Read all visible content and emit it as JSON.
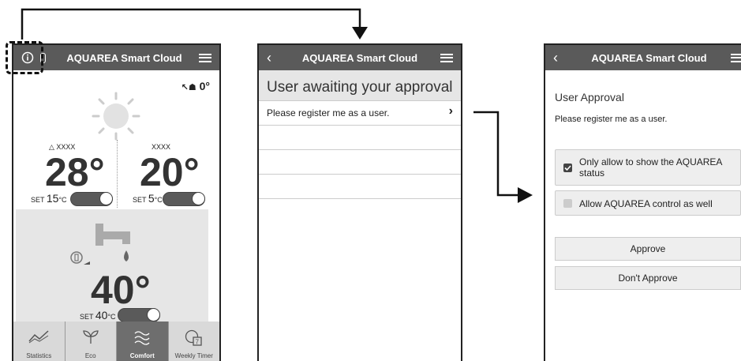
{
  "app_title": "AQUAREA Smart Cloud",
  "screen1": {
    "outdoor_temp": "0°",
    "zone1": {
      "name": "XXXX",
      "temp": "28°",
      "set_prefix": "SET",
      "set_value": "15",
      "set_unit": "°C"
    },
    "zone2": {
      "name": "XXXX",
      "temp": "20°",
      "set_prefix": "SET",
      "set_value": "5",
      "set_unit": "°C"
    },
    "tank": {
      "temp": "40°",
      "set_prefix": "SET",
      "set_value": "40",
      "set_unit": "°C"
    },
    "tabs": [
      {
        "label": "Statistics",
        "icon": "chart-line-icon"
      },
      {
        "label": "Eco",
        "icon": "leaf-icon"
      },
      {
        "label": "Comfort",
        "icon": "waves-icon"
      },
      {
        "label": "Weekly Timer",
        "icon": "weekly-timer-icon"
      }
    ],
    "active_tab": "Comfort"
  },
  "screen2": {
    "title": "User awaiting your approval",
    "request": "Please register me as a user."
  },
  "screen3": {
    "title": "User Approval",
    "message": "Please register me as a user.",
    "options": [
      {
        "label": "Only allow to show the AQUAREA status",
        "checked": true
      },
      {
        "label": "Allow AQUAREA control as well",
        "checked": false
      }
    ],
    "approve": "Approve",
    "dont_approve": "Don't Approve"
  },
  "colors": {
    "header": "#5a5a5a",
    "panel": "#e6e6e6",
    "tab_active": "#6e6e6e"
  }
}
